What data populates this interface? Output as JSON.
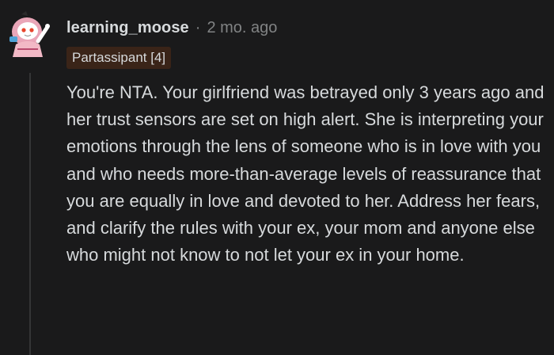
{
  "comment": {
    "username": "learning_moose",
    "separator": "·",
    "timestamp": "2 mo. ago",
    "flair": "Partassipant [4]",
    "body": "You're NTA. Your girlfriend was betrayed only 3 years ago and her trust sensors are set on high alert. She is interpreting your emotions through the lens of someone who is in love with you and who needs more-than-average levels of reassurance that you are equally in love and devoted to her. Address her fears, and clarify the rules with your ex, your mom and anyone else who might not know to not let your ex in your home."
  },
  "avatar": {
    "icon": "snoo-avatar-icon"
  },
  "colors": {
    "background": "#1a1a1b",
    "text": "#d7dadc",
    "meta": "#818384",
    "flair_bg": "#3a2418",
    "thread_line": "#343536"
  }
}
